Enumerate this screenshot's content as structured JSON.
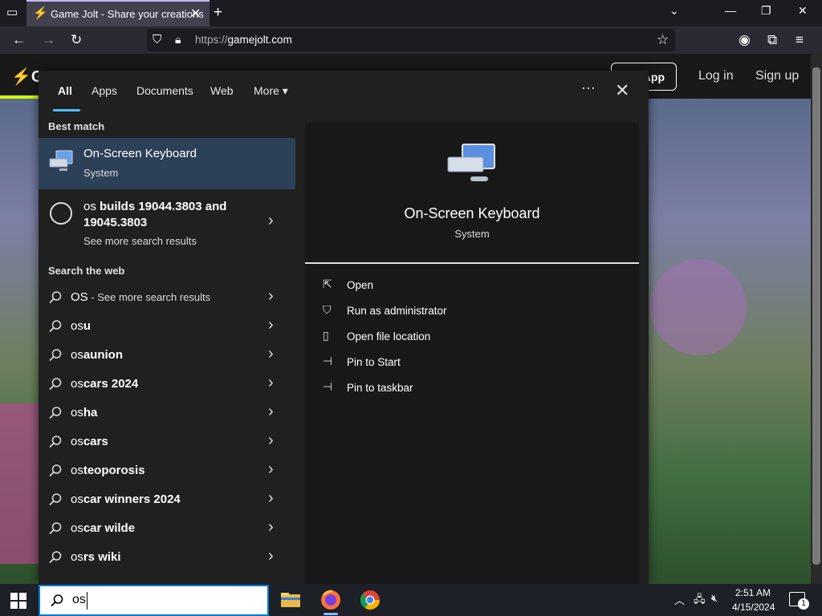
{
  "browser": {
    "tab_title": "Game Jolt - Share your creations",
    "url_prefix": "https://",
    "url_domain": "gamejolt.com"
  },
  "site": {
    "app_label": "App",
    "login_label": "Log in",
    "signup_label": "Sign up"
  },
  "search_panel": {
    "tabs": [
      {
        "label": "All",
        "active": true
      },
      {
        "label": "Apps"
      },
      {
        "label": "Documents"
      },
      {
        "label": "Web"
      },
      {
        "label": "More"
      }
    ],
    "more_caret": "▾",
    "options_glyph": "⋯",
    "close_glyph": "✕",
    "best_match_header": "Best match",
    "best_match": {
      "name": "On-Screen Keyboard",
      "type": "System"
    },
    "builds_item": {
      "prefix": "os",
      "rest": " builds 19044.3803 and 19045.3803",
      "more": "See more search results"
    },
    "web_header": "Search the web",
    "web_results": [
      {
        "prefix": "OS",
        "rest": "",
        "extra": " - See more search results"
      },
      {
        "prefix": "os",
        "rest": "u",
        "extra": ""
      },
      {
        "prefix": "os",
        "rest": "aunion",
        "extra": ""
      },
      {
        "prefix": "os",
        "rest": "cars 2024",
        "extra": ""
      },
      {
        "prefix": "os",
        "rest": "ha",
        "extra": ""
      },
      {
        "prefix": "os",
        "rest": "cars",
        "extra": ""
      },
      {
        "prefix": "os",
        "rest": "teoporosis",
        "extra": ""
      },
      {
        "prefix": "os",
        "rest": "car winners 2024",
        "extra": ""
      },
      {
        "prefix": "os",
        "rest": "car wilde",
        "extra": ""
      },
      {
        "prefix": "os",
        "rest": "rs wiki",
        "extra": ""
      }
    ],
    "detail": {
      "name": "On-Screen Keyboard",
      "type": "System",
      "actions": [
        {
          "label": "Open",
          "icon": "open-icon"
        },
        {
          "label": "Run as administrator",
          "icon": "shield-run-icon"
        },
        {
          "label": "Open file location",
          "icon": "file-location-icon"
        },
        {
          "label": "Pin to Start",
          "icon": "pin-icon"
        },
        {
          "label": "Pin to taskbar",
          "icon": "pin-icon"
        }
      ]
    }
  },
  "taskbar": {
    "search_value": "os",
    "time": "2:51 AM",
    "date": "4/15/2024",
    "notification_count": "1",
    "apps": [
      "file-explorer-icon",
      "firefox-icon",
      "chrome-icon"
    ]
  }
}
